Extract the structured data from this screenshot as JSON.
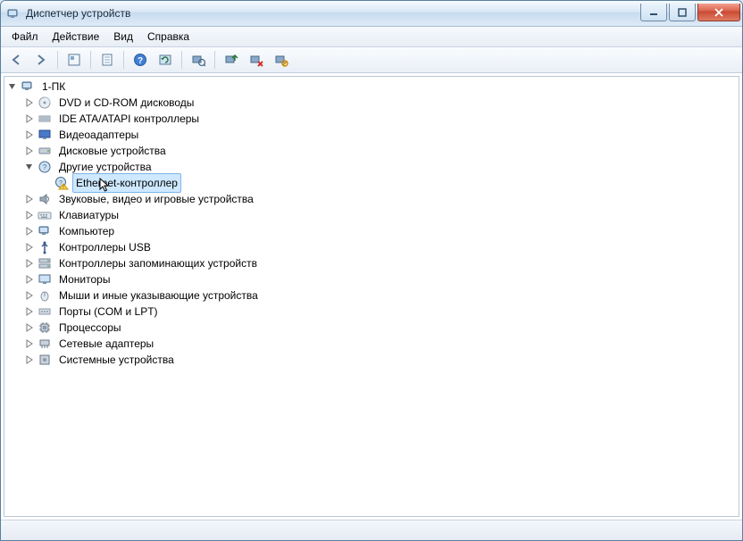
{
  "window": {
    "title": "Диспетчер устройств"
  },
  "menu": {
    "file": "Файл",
    "action": "Действие",
    "view": "Вид",
    "help": "Справка"
  },
  "toolbar_icons": {
    "back": "back",
    "forward": "forward",
    "show_hidden": "show-hidden",
    "properties": "properties",
    "help": "help",
    "refresh": "refresh",
    "scan": "scan",
    "update": "update-driver",
    "uninstall": "uninstall",
    "disable": "disable"
  },
  "tree": {
    "root": {
      "label": "1-ПК",
      "icon": "computer",
      "expanded": true,
      "children": [
        {
          "label": "DVD и CD-ROM дисководы",
          "icon": "cdrom",
          "expanded": false,
          "hasChildren": true
        },
        {
          "label": "IDE ATA/ATAPI контроллеры",
          "icon": "ide",
          "expanded": false,
          "hasChildren": true
        },
        {
          "label": "Видеоадаптеры",
          "icon": "display",
          "expanded": false,
          "hasChildren": true
        },
        {
          "label": "Дисковые устройства",
          "icon": "disk",
          "expanded": false,
          "hasChildren": true
        },
        {
          "label": "Другие устройства",
          "icon": "other",
          "expanded": true,
          "hasChildren": true,
          "children": [
            {
              "label": "Ethernet-контроллер",
              "icon": "unknown-warn",
              "selected": true,
              "hasChildren": false,
              "cursor": true
            }
          ]
        },
        {
          "label": "Звуковые, видео и игровые устройства",
          "icon": "sound",
          "expanded": false,
          "hasChildren": true
        },
        {
          "label": "Клавиатуры",
          "icon": "keyboard",
          "expanded": false,
          "hasChildren": true
        },
        {
          "label": "Компьютер",
          "icon": "computer",
          "expanded": false,
          "hasChildren": true
        },
        {
          "label": "Контроллеры USB",
          "icon": "usb",
          "expanded": false,
          "hasChildren": true
        },
        {
          "label": "Контроллеры запоминающих устройств",
          "icon": "storage",
          "expanded": false,
          "hasChildren": true
        },
        {
          "label": "Мониторы",
          "icon": "monitor",
          "expanded": false,
          "hasChildren": true
        },
        {
          "label": "Мыши и иные указывающие устройства",
          "icon": "mouse",
          "expanded": false,
          "hasChildren": true
        },
        {
          "label": "Порты (COM и LPT)",
          "icon": "ports",
          "expanded": false,
          "hasChildren": true
        },
        {
          "label": "Процессоры",
          "icon": "cpu",
          "expanded": false,
          "hasChildren": true
        },
        {
          "label": "Сетевые адаптеры",
          "icon": "network",
          "expanded": false,
          "hasChildren": true
        },
        {
          "label": "Системные устройства",
          "icon": "system",
          "expanded": false,
          "hasChildren": true
        }
      ]
    }
  }
}
